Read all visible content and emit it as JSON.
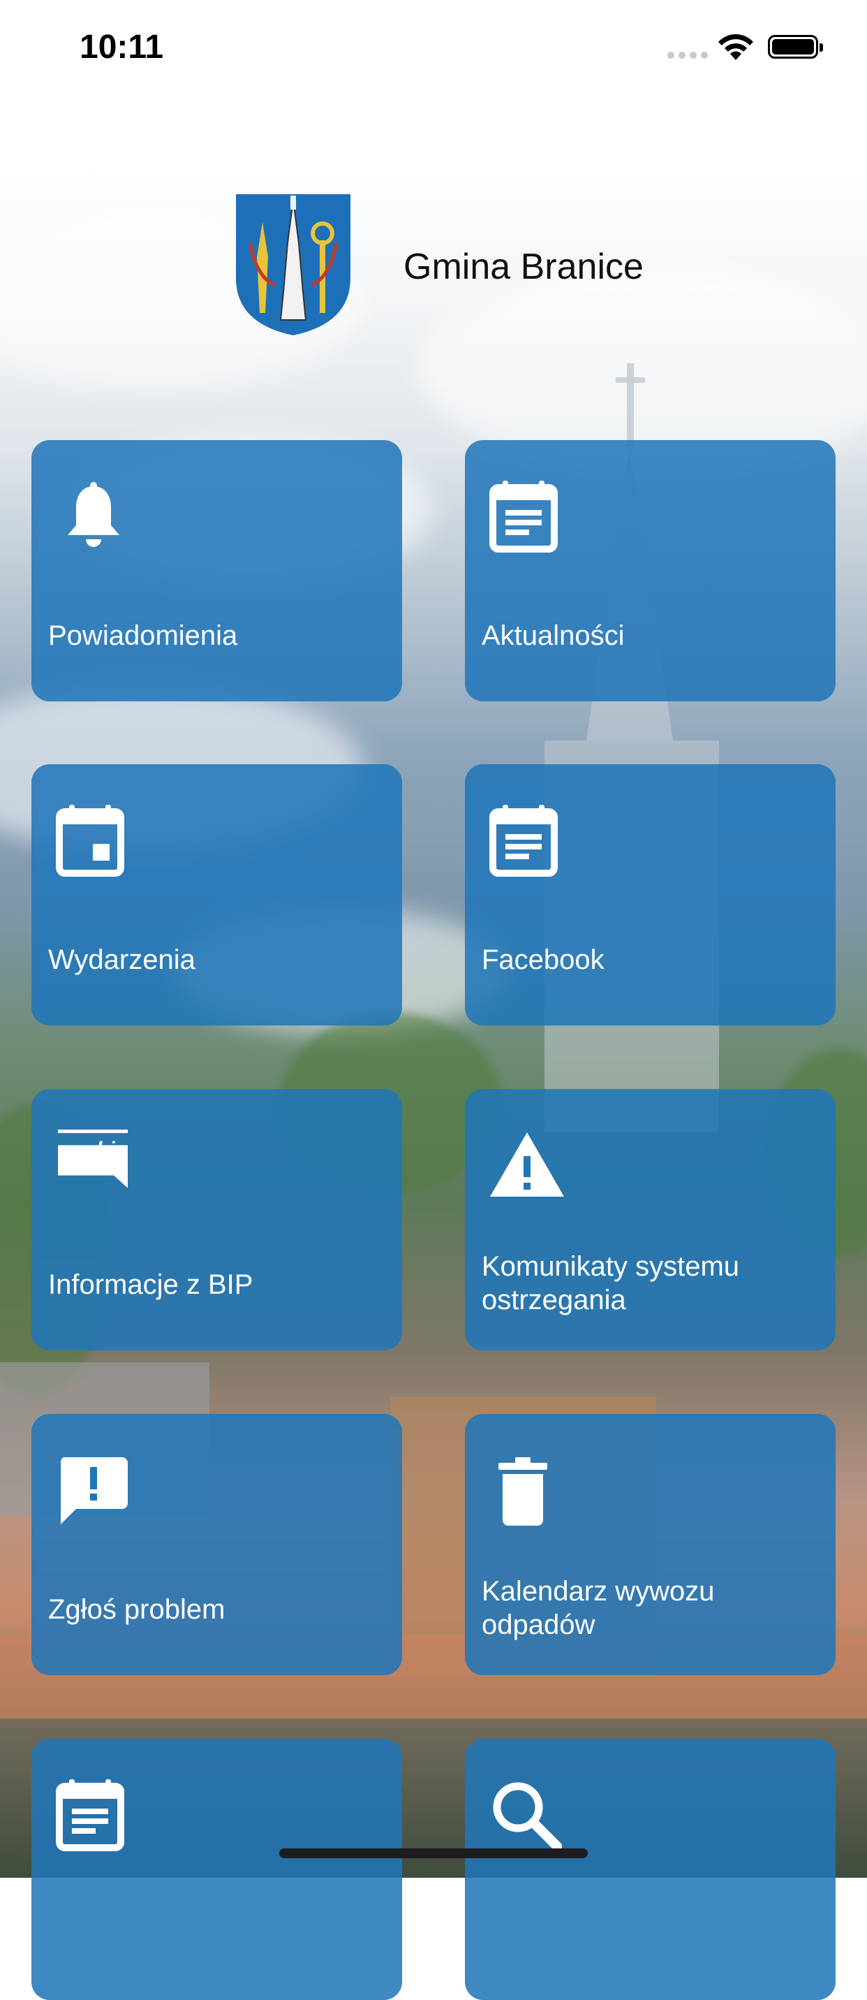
{
  "status_bar": {
    "time": "10:11"
  },
  "header": {
    "title": "Gmina Branice",
    "crest_icon": "coat-of-arms-icon"
  },
  "colors": {
    "tile": "#1f76b9",
    "tile_text": "#ffffff",
    "title_text": "#111111"
  },
  "tiles": [
    {
      "label": "Powiadomienia",
      "icon": "bell-icon"
    },
    {
      "label": "Aktualności",
      "icon": "news-icon"
    },
    {
      "label": "Wydarzenia",
      "icon": "calendar-icon"
    },
    {
      "label": "Facebook",
      "icon": "news-icon"
    },
    {
      "label": "Informacje z BIP",
      "icon": "bip-icon",
      "icon_text": "bip"
    },
    {
      "label": "Komunikaty systemu ostrzegania",
      "icon": "warning-icon"
    },
    {
      "label": "Zgłoś problem",
      "icon": "report-problem-icon"
    },
    {
      "label": "Kalendarz wywozu odpadów",
      "icon": "trash-icon"
    },
    {
      "label": "",
      "icon": "news-icon"
    },
    {
      "label": "",
      "icon": "search-icon"
    }
  ]
}
